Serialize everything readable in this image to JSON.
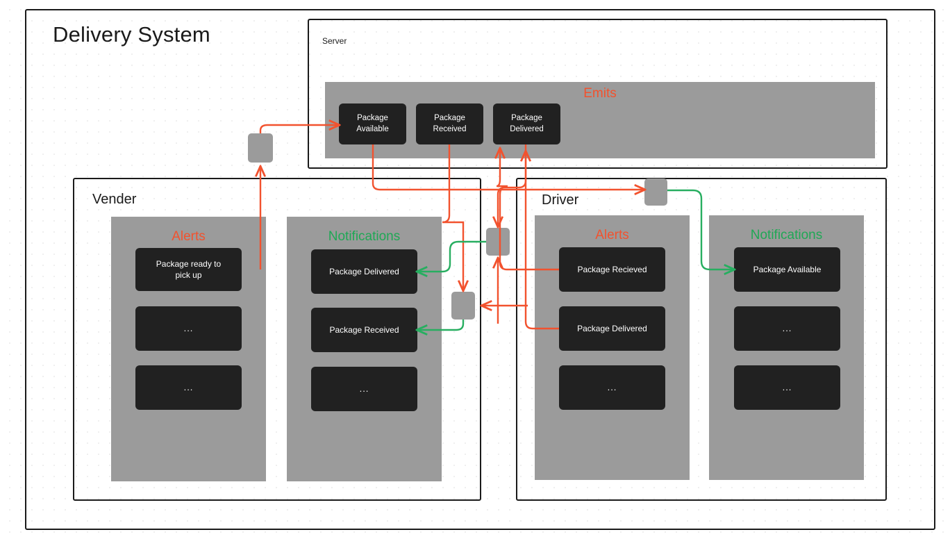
{
  "diagram": {
    "title": "Delivery System",
    "colors": {
      "alert": "#f2522e",
      "notification": "#1fa855",
      "panel": "#9b9b9b",
      "card": "#212121",
      "frame": "#1a1a1a",
      "background": "#ffffff"
    }
  },
  "server": {
    "label": "Server",
    "emits": {
      "title": "Emits",
      "events": [
        {
          "label": "Package\nAvailable",
          "line1": "Package",
          "line2": "Available"
        },
        {
          "label": "Package\nReceived",
          "line1": "Package",
          "line2": "Received"
        },
        {
          "label": "Package\nDelivered",
          "line1": "Package",
          "line2": "Delivered"
        }
      ]
    }
  },
  "vender": {
    "label": "Vender",
    "alerts": {
      "title": "Alerts",
      "items": [
        {
          "line1": "Package ready to",
          "line2": "pick up"
        },
        {
          "line1": "...",
          "line2": ""
        },
        {
          "line1": "...",
          "line2": ""
        }
      ]
    },
    "notifications": {
      "title": "Notifications",
      "items": [
        {
          "line1": "Package Delivered",
          "line2": ""
        },
        {
          "line1": "Package Received",
          "line2": ""
        },
        {
          "line1": "...",
          "line2": ""
        }
      ]
    }
  },
  "driver": {
    "label": "Driver",
    "alerts": {
      "title": "Alerts",
      "items": [
        {
          "line1": "Package Recieved",
          "line2": ""
        },
        {
          "line1": "Package Delivered",
          "line2": ""
        },
        {
          "line1": "...",
          "line2": ""
        }
      ]
    },
    "notifications": {
      "title": "Notifications",
      "items": [
        {
          "line1": "Package Available",
          "line2": ""
        },
        {
          "line1": "...",
          "line2": ""
        },
        {
          "line1": "...",
          "line2": ""
        }
      ]
    }
  },
  "connectors": {
    "nodes": [
      {
        "name": "vender-alert-emitter-node"
      },
      {
        "name": "vender-notification-receiver-node"
      },
      {
        "name": "vender-notification-receiver-node-2"
      },
      {
        "name": "driver-alert-emitter-node"
      }
    ],
    "flows": [
      {
        "from": "vender-alert-package-ready",
        "to": "server-package-available",
        "color": "alert"
      },
      {
        "from": "server-package-available",
        "to": "driver-notification-node",
        "color": "alert"
      },
      {
        "from": "driver-notification-node",
        "to": "driver-notification-package-available",
        "color": "notification"
      },
      {
        "from": "driver-alert-package-recieved",
        "to": "server-package-received",
        "color": "alert"
      },
      {
        "from": "server-package-received",
        "to": "vender-notification-node-received",
        "color": "alert"
      },
      {
        "from": "vender-notification-node-received",
        "to": "vender-notification-package-received",
        "color": "notification"
      },
      {
        "from": "driver-alert-package-delivered",
        "to": "server-package-delivered",
        "color": "alert"
      },
      {
        "from": "server-package-delivered",
        "to": "vender-notification-node-delivered",
        "color": "alert"
      },
      {
        "from": "vender-notification-node-delivered",
        "to": "vender-notification-package-delivered",
        "color": "notification"
      }
    ]
  }
}
